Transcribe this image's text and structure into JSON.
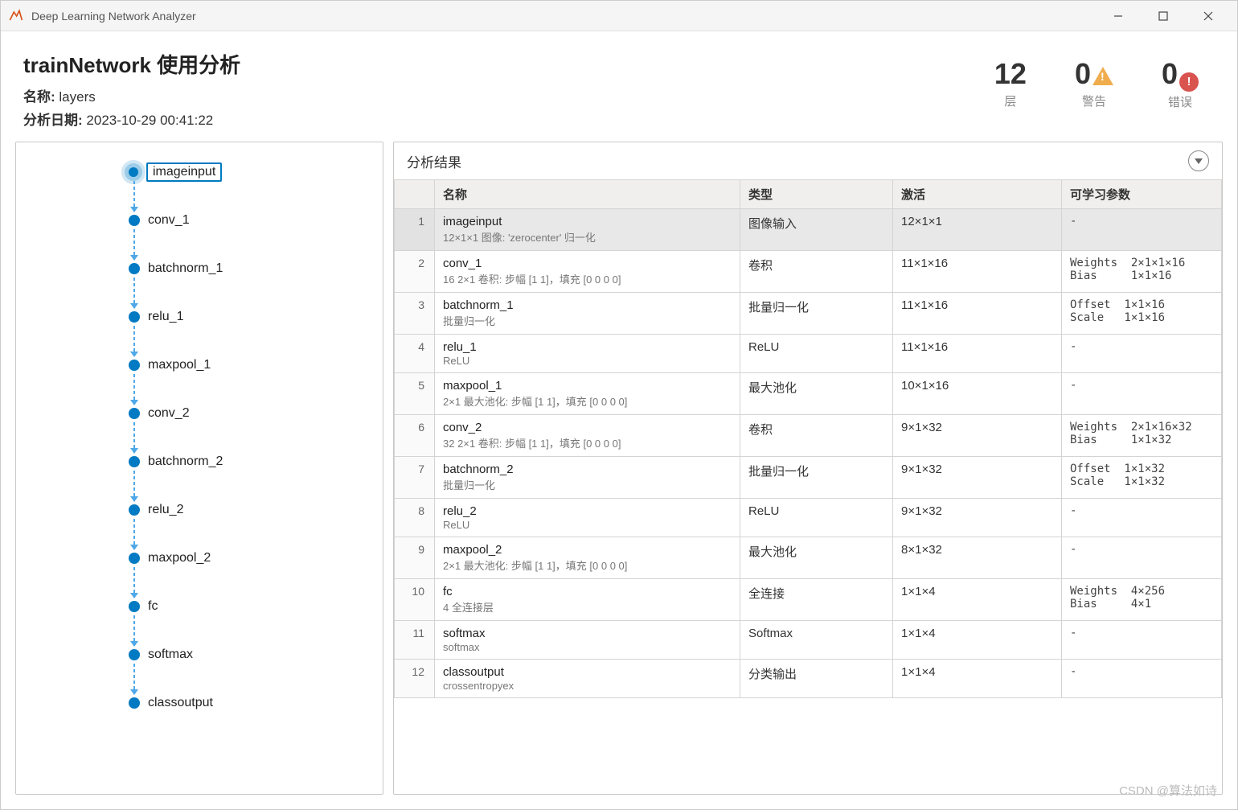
{
  "window": {
    "title": "Deep Learning Network Analyzer"
  },
  "header": {
    "title": "trainNetwork 使用分析",
    "name_label": "名称:",
    "name_value": "layers",
    "date_label": "分析日期:",
    "date_value": "2023-10-29 00:41:22"
  },
  "stats": {
    "layers": {
      "value": "12",
      "label": "层"
    },
    "warnings": {
      "value": "0",
      "label": "警告"
    },
    "errors": {
      "value": "0",
      "label": "错误"
    }
  },
  "graph": {
    "nodes": [
      "imageinput",
      "conv_1",
      "batchnorm_1",
      "relu_1",
      "maxpool_1",
      "conv_2",
      "batchnorm_2",
      "relu_2",
      "maxpool_2",
      "fc",
      "softmax",
      "classoutput"
    ],
    "selected": 0
  },
  "table": {
    "title": "分析结果",
    "columns": {
      "idx": "",
      "name": "名称",
      "type": "类型",
      "activation": "激活",
      "params": "可学习参数"
    },
    "rows": [
      {
        "name": "imageinput",
        "sub": "12×1×1 图像: 'zerocenter' 归一化",
        "type": "图像输入",
        "activation": "12×1×1",
        "params": "-",
        "selected": true
      },
      {
        "name": "conv_1",
        "sub": "16 2×1 卷积: 步幅 [1 1]，填充 [0 0 0 0]",
        "type": "卷积",
        "activation": "11×1×16",
        "params": "Weights  2×1×1×16\nBias     1×1×16"
      },
      {
        "name": "batchnorm_1",
        "sub": "批量归一化",
        "type": "批量归一化",
        "activation": "11×1×16",
        "params": "Offset  1×1×16\nScale   1×1×16"
      },
      {
        "name": "relu_1",
        "sub": "ReLU",
        "type": "ReLU",
        "activation": "11×1×16",
        "params": "-"
      },
      {
        "name": "maxpool_1",
        "sub": "2×1 最大池化: 步幅 [1 1]，填充 [0 0 0 0]",
        "type": "最大池化",
        "activation": "10×1×16",
        "params": "-"
      },
      {
        "name": "conv_2",
        "sub": "32 2×1 卷积: 步幅 [1 1]，填充 [0 0 0 0]",
        "type": "卷积",
        "activation": "9×1×32",
        "params": "Weights  2×1×16×32\nBias     1×1×32"
      },
      {
        "name": "batchnorm_2",
        "sub": "批量归一化",
        "type": "批量归一化",
        "activation": "9×1×32",
        "params": "Offset  1×1×32\nScale   1×1×32"
      },
      {
        "name": "relu_2",
        "sub": "ReLU",
        "type": "ReLU",
        "activation": "9×1×32",
        "params": "-"
      },
      {
        "name": "maxpool_2",
        "sub": "2×1 最大池化: 步幅 [1 1]，填充 [0 0 0 0]",
        "type": "最大池化",
        "activation": "8×1×32",
        "params": "-"
      },
      {
        "name": "fc",
        "sub": "4 全连接层",
        "type": "全连接",
        "activation": "1×1×4",
        "params": "Weights  4×256\nBias     4×1"
      },
      {
        "name": "softmax",
        "sub": "softmax",
        "type": "Softmax",
        "activation": "1×1×4",
        "params": "-"
      },
      {
        "name": "classoutput",
        "sub": "crossentropyex",
        "type": "分类输出",
        "activation": "1×1×4",
        "params": "-"
      }
    ]
  },
  "watermark": "CSDN @算法如诗"
}
